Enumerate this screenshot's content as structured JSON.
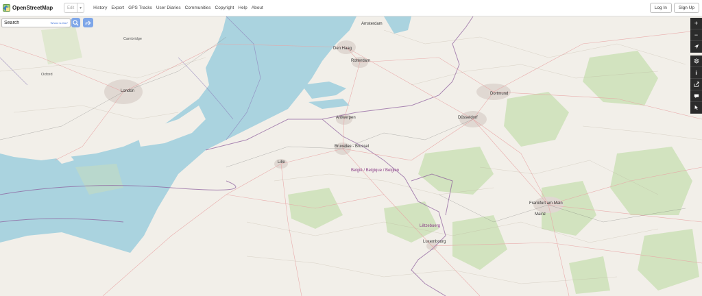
{
  "app": {
    "brand": "OpenStreetMap"
  },
  "header": {
    "edit_label": "Edit",
    "nav": [
      "History",
      "Export",
      "GPS Tracks",
      "User Diaries",
      "Communities",
      "Copyright",
      "Help",
      "About"
    ],
    "login": "Log In",
    "signup": "Sign Up"
  },
  "search": {
    "placeholder": "Search",
    "where_link": "Where is this?"
  },
  "toolbar": {
    "icons": [
      "zoom-in-icon",
      "zoom-out-icon",
      "locate-icon",
      "layers-icon",
      "info-icon",
      "share-icon",
      "note-icon",
      "query-icon"
    ]
  },
  "map": {
    "labels": {
      "amsterdam": "Amsterdam",
      "den_haag": "Den Haag",
      "rotterdam": "Rotterdam",
      "antwerpen": "Antwerpen",
      "brussel": "Bruxelles - Brussel",
      "belgie": "België / Belgique / Belgien",
      "luxembourg": "Lëtzebuerg",
      "luxembourg_city": "Luxembourg",
      "dortmund": "Dortmund",
      "dusseldorf": "Düsseldorf",
      "frankfurt": "Frankfurt am Main",
      "london": "London",
      "mainz": "Mainz",
      "lille": "Lille",
      "oxford": "Oxford",
      "cambridge": "Cambridge"
    }
  },
  "colors": {
    "sea": "#aad3df",
    "land": "#f2efe9",
    "forest": "#cde1b8",
    "button_blue": "#7ea6e8",
    "toolbar": "#2b2b2b"
  }
}
